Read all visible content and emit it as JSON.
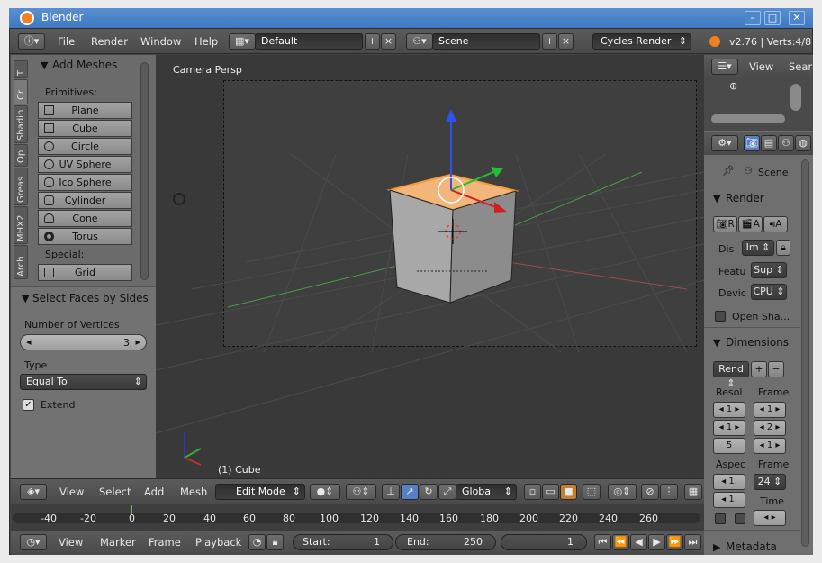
{
  "window": {
    "title": "Blender"
  },
  "colors": {
    "titlebar": "#4a82c8",
    "bg": "#454545",
    "panel": "#6b6b6b",
    "viewport": "#393939",
    "selected_face": "#f0a050",
    "axis_x": "#c03030",
    "axis_y": "#30b030",
    "axis_z": "#3030e0"
  },
  "top_header": {
    "menus": [
      "File",
      "Render",
      "Window",
      "Help"
    ],
    "screen": "Default",
    "scene": "Scene",
    "engine": "Cycles Render",
    "info": "v2.76 | Verts:4/8"
  },
  "toolshelf": {
    "tabs": [
      "T",
      "Cr",
      "Shadin",
      "Op",
      "Greas",
      "MHX2",
      "Arch"
    ],
    "panel_title": "Add Meshes",
    "primitives_label": "Primitives:",
    "primitives": [
      "Plane",
      "Cube",
      "Circle",
      "UV Sphere",
      "Ico Sphere",
      "Cylinder",
      "Cone",
      "Torus"
    ],
    "special_label": "Special:",
    "special": [
      "Grid"
    ],
    "op_title": "Select Faces by Sides",
    "num_vertices_label": "Number of Vertices",
    "num_vertices": "3",
    "type_label": "Type",
    "type_value": "Equal To",
    "extend_label": "Extend",
    "extend_checked": true
  },
  "viewport": {
    "view_name": "Camera Persp",
    "object_label": "(1) Cube"
  },
  "view_header": {
    "menus": [
      "View",
      "Select",
      "Add",
      "Mesh"
    ],
    "mode": "Edit Mode",
    "orientation": "Global"
  },
  "timeline": {
    "ticks": [
      "-40",
      "-20",
      "0",
      "20",
      "40",
      "60",
      "80",
      "100",
      "120",
      "140",
      "160",
      "180",
      "200",
      "220",
      "240",
      "260"
    ],
    "menus": [
      "View",
      "Marker",
      "Frame",
      "Playback"
    ],
    "start_label": "Start:",
    "start": "1",
    "end_label": "End:",
    "end": "250",
    "current": "1"
  },
  "right": {
    "outliner_view": "View",
    "outliner_search": "Sear",
    "scene_label": "Scene",
    "render_panel": "Render",
    "display_label": "Dis",
    "display_value": "Im",
    "feature_label": "Featu",
    "feature_value": "Sup",
    "device_label": "Devic",
    "device_value": "CPU",
    "open_shading": "Open Sha...",
    "dimensions_panel": "Dimensions",
    "preset": "Rend",
    "resolution_label": "Resol",
    "frame_label": "Frame",
    "res_values": [
      "1",
      "1",
      "5"
    ],
    "frame_values": [
      "1",
      "2",
      "1"
    ],
    "aspect_label": "Aspec",
    "aspect_values": [
      "1.",
      "1."
    ],
    "frame_rate_label": "Frame",
    "frame_rate": "24",
    "time_label": "Time",
    "metadata_panel": "Metadata"
  }
}
